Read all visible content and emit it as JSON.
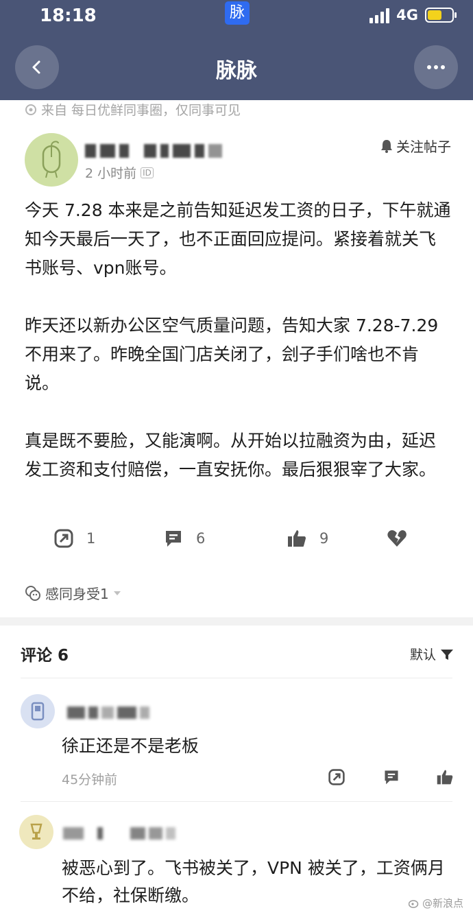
{
  "status_bar": {
    "time": "18:18",
    "app_badge": "脉",
    "network": "4G",
    "battery_level": 0.6,
    "battery_color": "#f3d21c"
  },
  "nav": {
    "title": "脉脉"
  },
  "post": {
    "source": "来自 每日优鲜同事圈，仅同事可见",
    "time": "2 小时前",
    "id_tag": "ID",
    "follow_label": "关注帖子",
    "paragraphs": [
      "今天 7.28 本来是之前告知延迟发工资的日子，下午就通知今天最后一天了，也不正面回应提问。紧接着就关飞书账号、vpn账号。",
      "昨天还以新办公区空气质量问题，告知大家 7.28-7.29 不用来了。昨晚全国门店关闭了，刽子手们啥也不肯说。",
      "真是既不要脸，又能演啊。从开始以拉融资为由，延迟发工资和支付赔偿，一直安抚你。最后狠狠宰了大家。"
    ],
    "actions": {
      "share": "1",
      "comments": "6",
      "likes": "9"
    },
    "reaction": "感同身受1"
  },
  "comments_section": {
    "title": "评论 6",
    "sort_label": "默认",
    "items": [
      {
        "text": "徐正还是不是老板",
        "time": "45分钟前"
      },
      {
        "text": "被恶心到了。飞书被关了，VPN 被关了，工资俩月不给，社保断缴。"
      }
    ]
  },
  "watermark": "@新浪点",
  "colors": {
    "header": "#4a5576",
    "avatar_bg": "#cfe0a4"
  }
}
